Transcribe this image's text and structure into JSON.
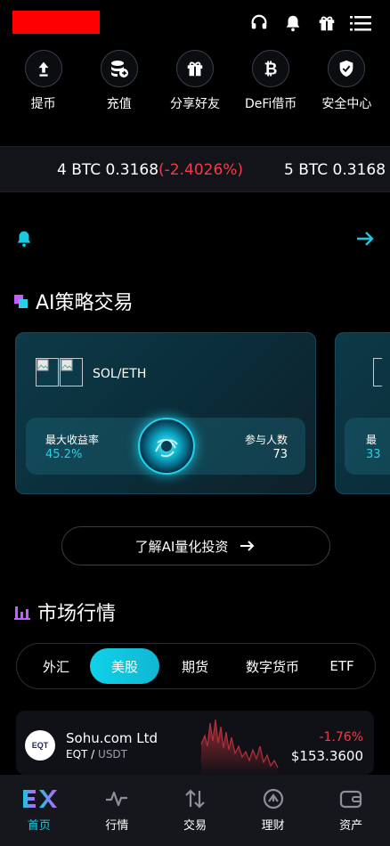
{
  "header": {
    "icons": [
      "headset-icon",
      "bell-icon",
      "gift-icon",
      "menu-icon"
    ]
  },
  "quick_actions": [
    {
      "label": "提币",
      "icon": "withdraw-icon"
    },
    {
      "label": "充值",
      "icon": "deposit-icon"
    },
    {
      "label": "分享好友",
      "icon": "gift-icon"
    },
    {
      "label": "DeFi借币",
      "icon": "bitcoin-icon"
    },
    {
      "label": "安全中心",
      "icon": "shield-icon"
    }
  ],
  "ticker": {
    "item1_prefix": "4 BTC 0.3168",
    "item1_change": "(-2.4026%)",
    "item2_prefix": "5 BTC 0.3168"
  },
  "ai_section": {
    "title": "AI策略交易",
    "card": {
      "pair": "SOL/ETH",
      "max_return_label": "最大收益率",
      "max_return_value": "45.2%",
      "participants_label": "参与人数",
      "participants_value": "73"
    },
    "peek_card": {
      "label_fragment": "最",
      "value_fragment": "33"
    },
    "learn_button": "了解AI量化投资"
  },
  "market_section": {
    "title": "市场行情",
    "tabs": [
      "外汇",
      "美股",
      "期货",
      "数字货币",
      "ETF"
    ],
    "active_tab": "美股",
    "rows": [
      {
        "name": "Sohu.com Ltd",
        "symbol": "EQT",
        "quote": "USDT",
        "change": "-1.76%",
        "price": "$153.3600",
        "logo_text": "EQT"
      }
    ]
  },
  "bottom_nav": [
    {
      "label": "首页",
      "icon": "home-logo-icon",
      "active": true
    },
    {
      "label": "行情",
      "icon": "pulse-icon",
      "active": false
    },
    {
      "label": "交易",
      "icon": "swap-icon",
      "active": false
    },
    {
      "label": "理财",
      "icon": "finance-icon",
      "active": false
    },
    {
      "label": "资产",
      "icon": "wallet-icon",
      "active": false
    }
  ],
  "colors": {
    "accent": "#19c9e2",
    "negative": "#f23b47",
    "background": "#000000"
  }
}
